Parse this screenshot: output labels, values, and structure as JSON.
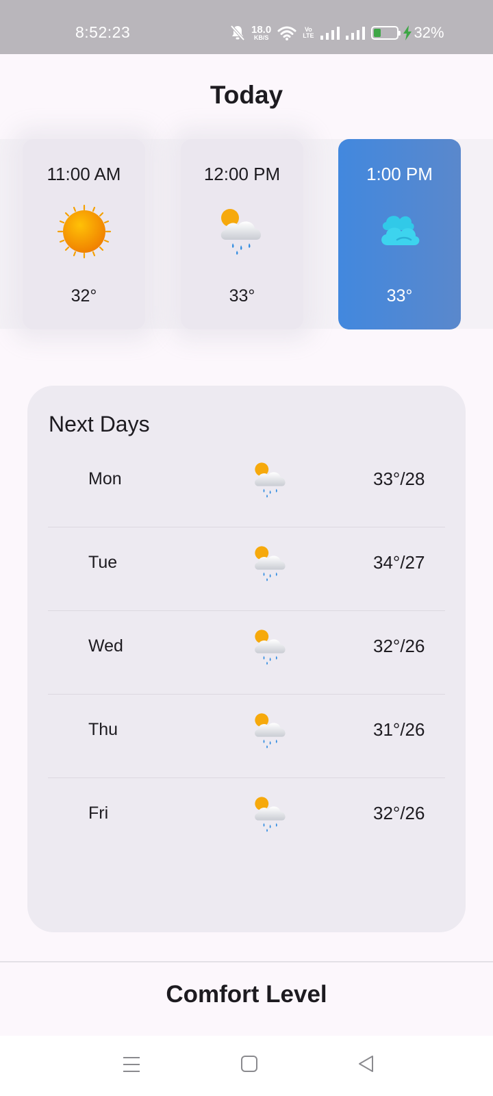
{
  "status_bar": {
    "time": "8:52:23",
    "net_speed_value": "18.0",
    "net_speed_unit": "KB/S",
    "volte_top": "Vo",
    "volte_bottom": "LTE",
    "battery_level": 0.32,
    "battery_percent": "32%",
    "icons": [
      "mute-bell-icon",
      "wifi-icon",
      "signal-icon",
      "battery-icon",
      "charging-bolt-icon"
    ]
  },
  "today": {
    "title": "Today",
    "hours": [
      {
        "time": "11:00 AM",
        "temp": "32°",
        "icon": "sun-icon",
        "selected": false
      },
      {
        "time": "12:00 PM",
        "temp": "33°",
        "icon": "sun-rain-cloud-icon",
        "selected": false
      },
      {
        "time": "1:00 PM",
        "temp": "33°",
        "icon": "cloud-icon",
        "selected": true
      }
    ]
  },
  "next_days": {
    "title": "Next Days",
    "days": [
      {
        "day": "Mon",
        "temp": "33°/28",
        "icon": "sun-rain-cloud-icon"
      },
      {
        "day": "Tue",
        "temp": "34°/27",
        "icon": "sun-rain-cloud-icon"
      },
      {
        "day": "Wed",
        "temp": "32°/26",
        "icon": "sun-rain-cloud-icon"
      },
      {
        "day": "Thu",
        "temp": "31°/26",
        "icon": "sun-rain-cloud-icon"
      },
      {
        "day": "Fri",
        "temp": "32°/26",
        "icon": "sun-rain-cloud-icon"
      }
    ]
  },
  "comfort": {
    "title": "Comfort Level"
  },
  "nav_bar": {
    "icons": [
      "menu-icon",
      "home-icon",
      "back-icon"
    ]
  },
  "colors": {
    "accent": "#4288de",
    "status_bar": "#b9b6bb",
    "background": "#fcf7fc",
    "card": "#edeaf1",
    "battery": "#3ea646"
  }
}
